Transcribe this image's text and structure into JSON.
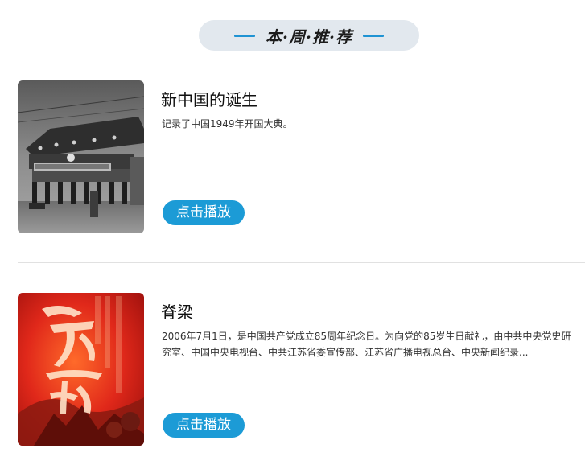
{
  "section": {
    "title": "本·周·推·荐",
    "accent_color": "#1f93d3",
    "pill_color": "#e2e8ee"
  },
  "items": [
    {
      "title": "新中国的诞生",
      "description": "记录了中国1949年开国大典。",
      "play_label": "点击播放",
      "thumbnail_icon": "black-white-building-photo"
    },
    {
      "title": "脊梁",
      "description": "2006年7月1日，是中国共产党成立85周年纪念日。为向党的85岁生日献礼，由中共中央党史研究室、中国中央电视台、中共江苏省委宣传部、江苏省广播电视总台、中央新闻纪录...",
      "play_label": "点击播放",
      "thumbnail_icon": "red-calligraphy-poster"
    }
  ],
  "colors": {
    "button": "#1c9bd6",
    "button_text": "#ffffff",
    "divider": "#e1e1e1"
  }
}
